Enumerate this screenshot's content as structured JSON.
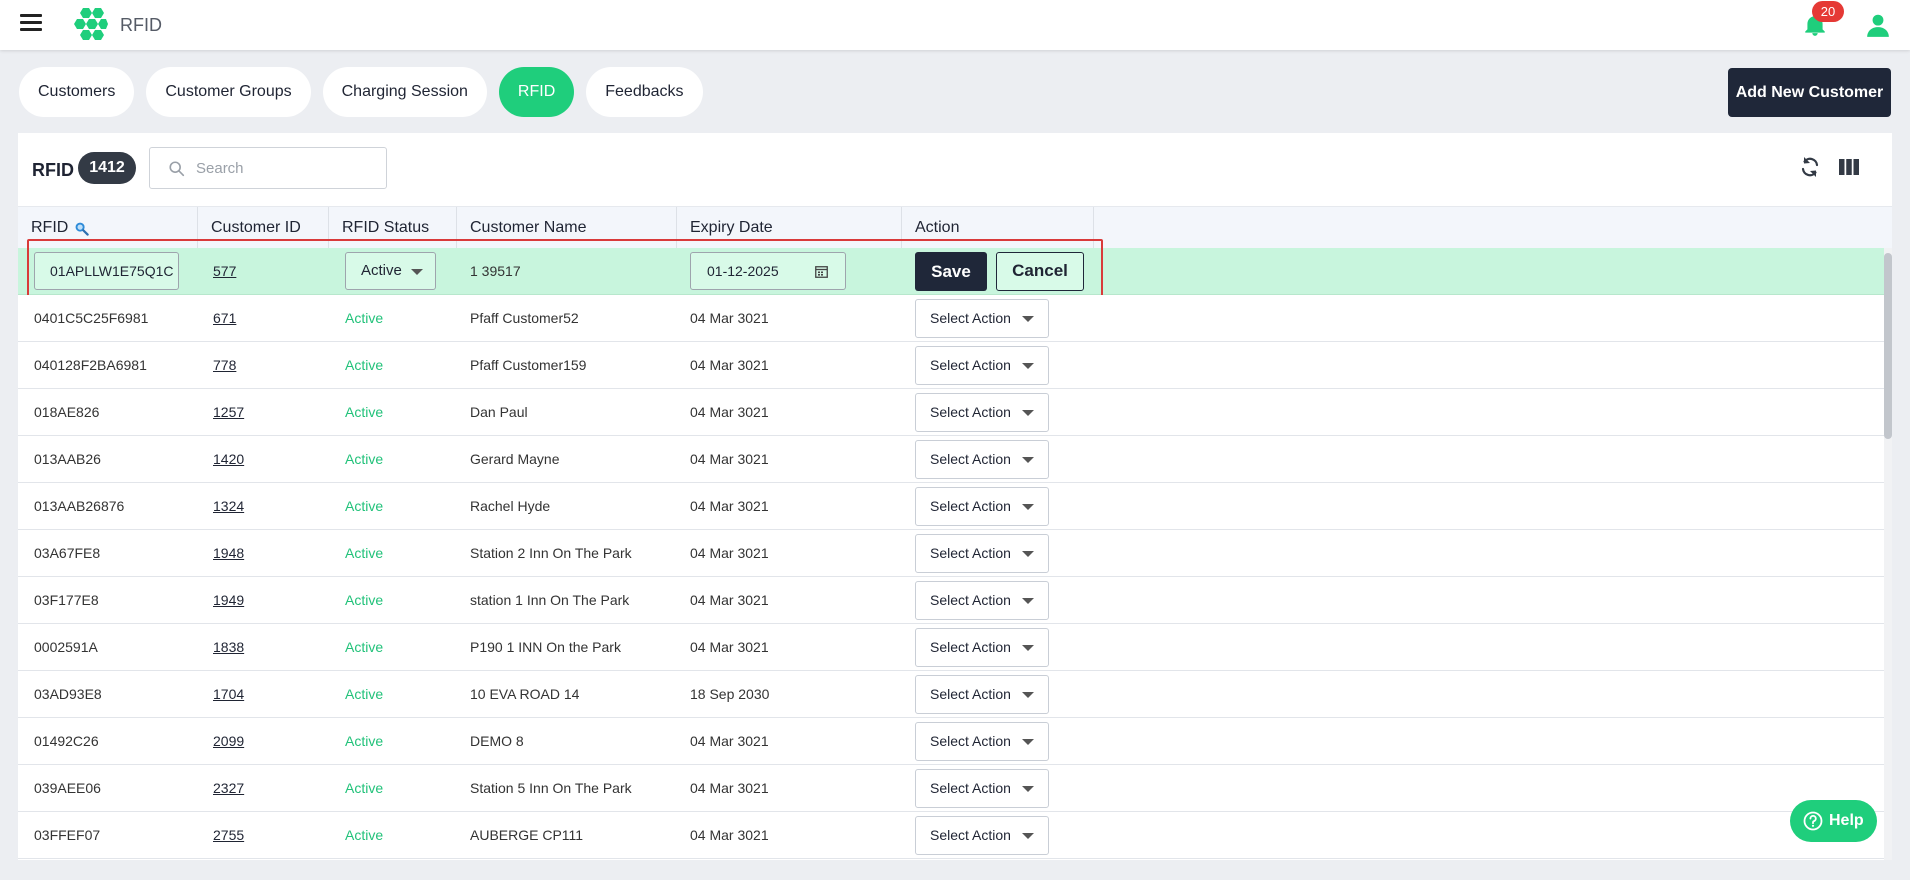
{
  "header": {
    "title": "RFID",
    "notification_count": "20"
  },
  "tabs": [
    {
      "label": "Customers",
      "active": false
    },
    {
      "label": "Customer Groups",
      "active": false
    },
    {
      "label": "Charging Session",
      "active": false
    },
    {
      "label": "RFID",
      "active": true
    },
    {
      "label": "Feedbacks",
      "active": false
    }
  ],
  "toolbar": {
    "add_customer_label": "Add New Customer"
  },
  "panel": {
    "title": "RFID",
    "count": "1412",
    "search_placeholder": "Search"
  },
  "table": {
    "columns": [
      "RFID",
      "Customer ID",
      "RFID Status",
      "Customer Name",
      "Expiry Date",
      "Action"
    ],
    "edit_row": {
      "rfid_value": "01APLLW1E75Q1C",
      "customer_id": "577",
      "status": "Active",
      "customer_name": "1 39517",
      "expiry_date": "01-12-2025",
      "save_label": "Save",
      "cancel_label": "Cancel"
    },
    "action_label": "Select Action",
    "rows": [
      {
        "rfid": "0401C5C25F6981",
        "customer_id": "671",
        "status": "Active",
        "customer_name": "Pfaff Customer52",
        "expiry": "04 Mar 3021"
      },
      {
        "rfid": "040128F2BA6981",
        "customer_id": "778",
        "status": "Active",
        "customer_name": "Pfaff Customer159",
        "expiry": "04 Mar 3021"
      },
      {
        "rfid": "018AE826",
        "customer_id": "1257",
        "status": "Active",
        "customer_name": "Dan Paul",
        "expiry": "04 Mar 3021"
      },
      {
        "rfid": "013AAB26",
        "customer_id": "1420",
        "status": "Active",
        "customer_name": "Gerard Mayne",
        "expiry": "04 Mar 3021"
      },
      {
        "rfid": "013AAB26876",
        "customer_id": "1324",
        "status": "Active",
        "customer_name": "Rachel Hyde",
        "expiry": "04 Mar 3021"
      },
      {
        "rfid": "03A67FE8",
        "customer_id": "1948",
        "status": "Active",
        "customer_name": "Station 2 Inn On The Park",
        "expiry": "04 Mar 3021"
      },
      {
        "rfid": "03F177E8",
        "customer_id": "1949",
        "status": "Active",
        "customer_name": "station 1 Inn On The Park",
        "expiry": "04 Mar 3021"
      },
      {
        "rfid": "0002591A",
        "customer_id": "1838",
        "status": "Active",
        "customer_name": "P190 1 INN On the Park",
        "expiry": "04 Mar 3021"
      },
      {
        "rfid": "03AD93E8",
        "customer_id": "1704",
        "status": "Active",
        "customer_name": "10 EVA ROAD 14",
        "expiry": "18 Sep 2030"
      },
      {
        "rfid": "01492C26",
        "customer_id": "2099",
        "status": "Active",
        "customer_name": "DEMO 8",
        "expiry": "04 Mar 3021"
      },
      {
        "rfid": "039AEE06",
        "customer_id": "2327",
        "status": "Active",
        "customer_name": "Station 5 Inn On The Park",
        "expiry": "04 Mar 3021"
      },
      {
        "rfid": "03FFEF07",
        "customer_id": "2755",
        "status": "Active",
        "customer_name": "AUBERGE CP111",
        "expiry": "04 Mar 3021"
      }
    ]
  },
  "help": {
    "label": "Help"
  },
  "colors": {
    "accent": "#1fce7c",
    "dark": "#1f2739",
    "badge": "#e53935",
    "edit_row": "#c8f5dd",
    "highlight": "#d93a3a"
  },
  "icons": [
    "menu-icon",
    "logo-icon",
    "bell-icon",
    "user-icon",
    "search-icon",
    "refresh-icon",
    "columns-icon",
    "calendar-icon",
    "caret-down-icon",
    "help-icon",
    "rfid-search-icon"
  ]
}
